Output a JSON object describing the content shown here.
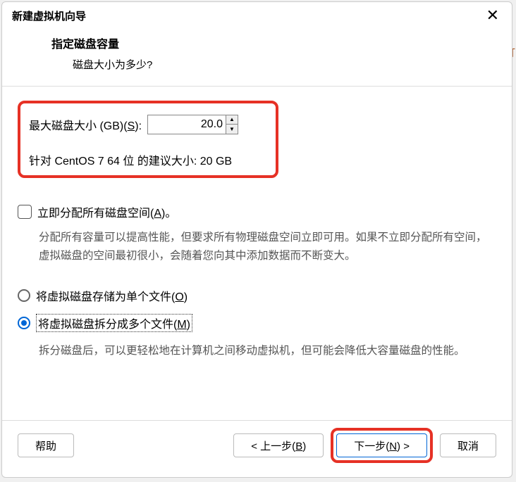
{
  "title": "新建虚拟机向导",
  "header": {
    "title": "指定磁盘容量",
    "subtitle": "磁盘大小为多少?"
  },
  "disk": {
    "max_size_label_pre": "最大磁盘大小 (GB)(",
    "max_size_key": "S",
    "max_size_label_post": "):",
    "max_size_value": "20.0",
    "recommended": "针对 CentOS 7 64 位 的建议大小: 20 GB"
  },
  "allocate": {
    "label_pre": "立即分配所有磁盘空间(",
    "key": "A",
    "label_post": ")。",
    "description": "分配所有容量可以提高性能，但要求所有物理磁盘空间立即可用。如果不立即分配所有空间，虚拟磁盘的空间最初很小，会随着您向其中添加数据而不断变大。"
  },
  "storage": {
    "single_pre": "将虚拟磁盘存储为单个文件(",
    "single_key": "O",
    "single_post": ")",
    "split_pre": "将虚拟磁盘拆分成多个文件(",
    "split_key": "M",
    "split_post": ")",
    "split_description": "拆分磁盘后，可以更轻松地在计算机之间移动虚拟机，但可能会降低大容量磁盘的性能。",
    "selected": "split"
  },
  "buttons": {
    "help": "帮助",
    "back_pre": "< 上一步(",
    "back_key": "B",
    "back_post": ")",
    "next_pre": "下一步(",
    "next_key": "N",
    "next_post": ") >",
    "cancel": "取消"
  }
}
